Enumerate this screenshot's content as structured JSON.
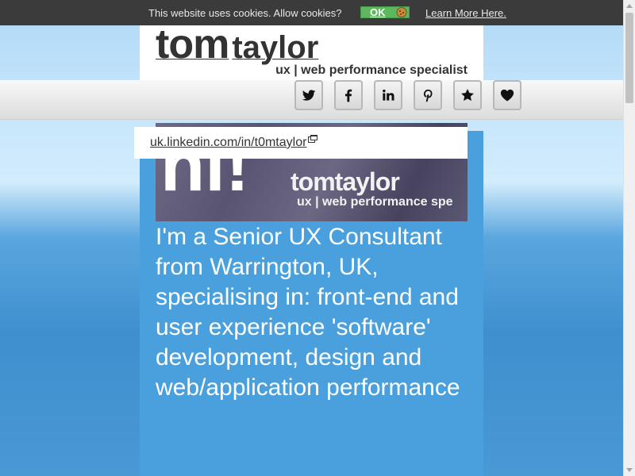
{
  "cookie_bar": {
    "message": "This website uses cookies. Allow cookies?",
    "ok_label": "OK",
    "learn_more": "Learn More Here."
  },
  "header": {
    "brand_first": "tom",
    "brand_last": "taylor",
    "tagline": "ux | web performance specialist"
  },
  "social": [
    {
      "name": "twitter-icon"
    },
    {
      "name": "facebook-icon"
    },
    {
      "name": "linkedin-icon"
    },
    {
      "name": "pinterest-icon"
    },
    {
      "name": "star-icon"
    },
    {
      "name": "heart-icon"
    }
  ],
  "hero": {
    "greeting": "hi!",
    "brand": "tomtaylor",
    "subtitle": "ux | web performance spe"
  },
  "link_popup": {
    "url": "uk.linkedin.com/in/t0mtaylor"
  },
  "intro": {
    "text": "I'm a Senior UX Consultant from Warrington, UK, specialising in: front-end and user experience 'software' development, design and web/application performance"
  },
  "colors": {
    "accent_blue": "#4aa0dc",
    "cookie_bar_bg": "#3b3b3b",
    "ok_green": "#5cb85c",
    "text_dark": "#333333"
  }
}
